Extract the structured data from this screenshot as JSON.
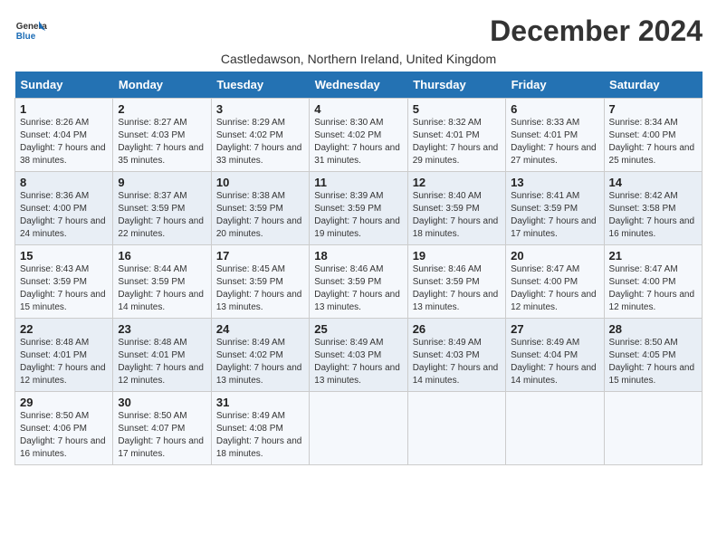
{
  "logo": {
    "text_general": "General",
    "text_blue": "Blue"
  },
  "title": "December 2024",
  "subtitle": "Castledawson, Northern Ireland, United Kingdom",
  "days_of_week": [
    "Sunday",
    "Monday",
    "Tuesday",
    "Wednesday",
    "Thursday",
    "Friday",
    "Saturday"
  ],
  "weeks": [
    [
      {
        "num": "1",
        "sunrise": "8:26 AM",
        "sunset": "4:04 PM",
        "daylight": "7 hours and 38 minutes."
      },
      {
        "num": "2",
        "sunrise": "8:27 AM",
        "sunset": "4:03 PM",
        "daylight": "7 hours and 35 minutes."
      },
      {
        "num": "3",
        "sunrise": "8:29 AM",
        "sunset": "4:02 PM",
        "daylight": "7 hours and 33 minutes."
      },
      {
        "num": "4",
        "sunrise": "8:30 AM",
        "sunset": "4:02 PM",
        "daylight": "7 hours and 31 minutes."
      },
      {
        "num": "5",
        "sunrise": "8:32 AM",
        "sunset": "4:01 PM",
        "daylight": "7 hours and 29 minutes."
      },
      {
        "num": "6",
        "sunrise": "8:33 AM",
        "sunset": "4:01 PM",
        "daylight": "7 hours and 27 minutes."
      },
      {
        "num": "7",
        "sunrise": "8:34 AM",
        "sunset": "4:00 PM",
        "daylight": "7 hours and 25 minutes."
      }
    ],
    [
      {
        "num": "8",
        "sunrise": "8:36 AM",
        "sunset": "4:00 PM",
        "daylight": "7 hours and 24 minutes."
      },
      {
        "num": "9",
        "sunrise": "8:37 AM",
        "sunset": "3:59 PM",
        "daylight": "7 hours and 22 minutes."
      },
      {
        "num": "10",
        "sunrise": "8:38 AM",
        "sunset": "3:59 PM",
        "daylight": "7 hours and 20 minutes."
      },
      {
        "num": "11",
        "sunrise": "8:39 AM",
        "sunset": "3:59 PM",
        "daylight": "7 hours and 19 minutes."
      },
      {
        "num": "12",
        "sunrise": "8:40 AM",
        "sunset": "3:59 PM",
        "daylight": "7 hours and 18 minutes."
      },
      {
        "num": "13",
        "sunrise": "8:41 AM",
        "sunset": "3:59 PM",
        "daylight": "7 hours and 17 minutes."
      },
      {
        "num": "14",
        "sunrise": "8:42 AM",
        "sunset": "3:58 PM",
        "daylight": "7 hours and 16 minutes."
      }
    ],
    [
      {
        "num": "15",
        "sunrise": "8:43 AM",
        "sunset": "3:59 PM",
        "daylight": "7 hours and 15 minutes."
      },
      {
        "num": "16",
        "sunrise": "8:44 AM",
        "sunset": "3:59 PM",
        "daylight": "7 hours and 14 minutes."
      },
      {
        "num": "17",
        "sunrise": "8:45 AM",
        "sunset": "3:59 PM",
        "daylight": "7 hours and 13 minutes."
      },
      {
        "num": "18",
        "sunrise": "8:46 AM",
        "sunset": "3:59 PM",
        "daylight": "7 hours and 13 minutes."
      },
      {
        "num": "19",
        "sunrise": "8:46 AM",
        "sunset": "3:59 PM",
        "daylight": "7 hours and 13 minutes."
      },
      {
        "num": "20",
        "sunrise": "8:47 AM",
        "sunset": "4:00 PM",
        "daylight": "7 hours and 12 minutes."
      },
      {
        "num": "21",
        "sunrise": "8:47 AM",
        "sunset": "4:00 PM",
        "daylight": "7 hours and 12 minutes."
      }
    ],
    [
      {
        "num": "22",
        "sunrise": "8:48 AM",
        "sunset": "4:01 PM",
        "daylight": "7 hours and 12 minutes."
      },
      {
        "num": "23",
        "sunrise": "8:48 AM",
        "sunset": "4:01 PM",
        "daylight": "7 hours and 12 minutes."
      },
      {
        "num": "24",
        "sunrise": "8:49 AM",
        "sunset": "4:02 PM",
        "daylight": "7 hours and 13 minutes."
      },
      {
        "num": "25",
        "sunrise": "8:49 AM",
        "sunset": "4:03 PM",
        "daylight": "7 hours and 13 minutes."
      },
      {
        "num": "26",
        "sunrise": "8:49 AM",
        "sunset": "4:03 PM",
        "daylight": "7 hours and 14 minutes."
      },
      {
        "num": "27",
        "sunrise": "8:49 AM",
        "sunset": "4:04 PM",
        "daylight": "7 hours and 14 minutes."
      },
      {
        "num": "28",
        "sunrise": "8:50 AM",
        "sunset": "4:05 PM",
        "daylight": "7 hours and 15 minutes."
      }
    ],
    [
      {
        "num": "29",
        "sunrise": "8:50 AM",
        "sunset": "4:06 PM",
        "daylight": "7 hours and 16 minutes."
      },
      {
        "num": "30",
        "sunrise": "8:50 AM",
        "sunset": "4:07 PM",
        "daylight": "7 hours and 17 minutes."
      },
      {
        "num": "31",
        "sunrise": "8:49 AM",
        "sunset": "4:08 PM",
        "daylight": "7 hours and 18 minutes."
      },
      null,
      null,
      null,
      null
    ]
  ]
}
